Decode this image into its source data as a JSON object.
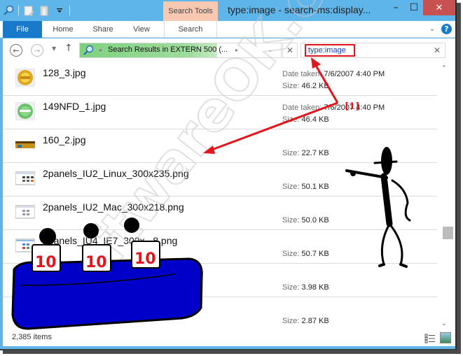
{
  "window": {
    "title": "type:image - search-ms:display...",
    "contextual_tab": "Search Tools",
    "controls": {
      "minimize": "–",
      "maximize": "☐",
      "close": "✕"
    }
  },
  "quick_access": {
    "icons": [
      "search-icon",
      "properties-icon",
      "new-folder-icon",
      "customize-dropdown-icon"
    ]
  },
  "ribbon": {
    "tabs": [
      {
        "label": "File",
        "active": true
      },
      {
        "label": "Home"
      },
      {
        "label": "Share"
      },
      {
        "label": "View"
      },
      {
        "label": "Search"
      }
    ],
    "expand_glyph": "⌄",
    "help_glyph": "?"
  },
  "navigation": {
    "back_glyph": "←",
    "forward_glyph": "→",
    "recent_glyph": "▼",
    "up_glyph": "↑",
    "address_icon_glyph": "⚲",
    "address_chevron": "▸",
    "address_path": "Search Results in EXTERN 500 (...",
    "address_dropdown_glyph": "⌄",
    "address_clear_glyph": "✕",
    "search_value": "type:image",
    "search_clear_glyph": "✕"
  },
  "files": [
    {
      "name": "128_3.jpg",
      "date_label": "Date taken:",
      "date": "7/6/2007 4:40 PM",
      "size_label": "Size:",
      "size": "46.2 KB",
      "thumb": "gold-seal"
    },
    {
      "name": "149NFD_1.jpg",
      "date_label": "Date taken:",
      "date": "7/6/2007 4:40 PM",
      "size_label": "Size:",
      "size": "46.4 KB",
      "thumb": "green-seal"
    },
    {
      "name": "160_2.jpg",
      "size_label": "Size:",
      "size": "22.7 KB",
      "thumb": "banner"
    },
    {
      "name": "2panels_IU2_Linux_300x235.png",
      "size_label": "Size:",
      "size": "50.1 KB",
      "thumb": "screenshot"
    },
    {
      "name": "2panels_IU2_Mac_300x218.png",
      "size_label": "Size:",
      "size": "50.0 KB",
      "thumb": "screenshot"
    },
    {
      "name": "2panels_IU4_IE7_300x...8.png",
      "size_label": "Size:",
      "size": "50.7 KB",
      "thumb": "screenshot"
    },
    {
      "name": "",
      "size_label": "Size:",
      "size": "3.98 KB",
      "thumb": "hidden"
    },
    {
      "name": "",
      "size_label": "Size:",
      "size": "2.87 KB",
      "thumb": "hidden"
    }
  ],
  "scrollbar": {
    "up_glyph": "⌃",
    "down_glyph": "⌄",
    "position_fraction": 0.62
  },
  "status": {
    "item_count": "2,385 items"
  },
  "annotation": {
    "label": "[1]",
    "color": "#e4141c"
  },
  "watermark": {
    "text": "SoftwareOK.com"
  },
  "colors": {
    "title_bar": "#5eb5ea",
    "file_tab": "#1979ca",
    "search_tools_tab": "#f8c9b0",
    "annotation_red": "#e4141c",
    "close_button": "#c75050"
  }
}
